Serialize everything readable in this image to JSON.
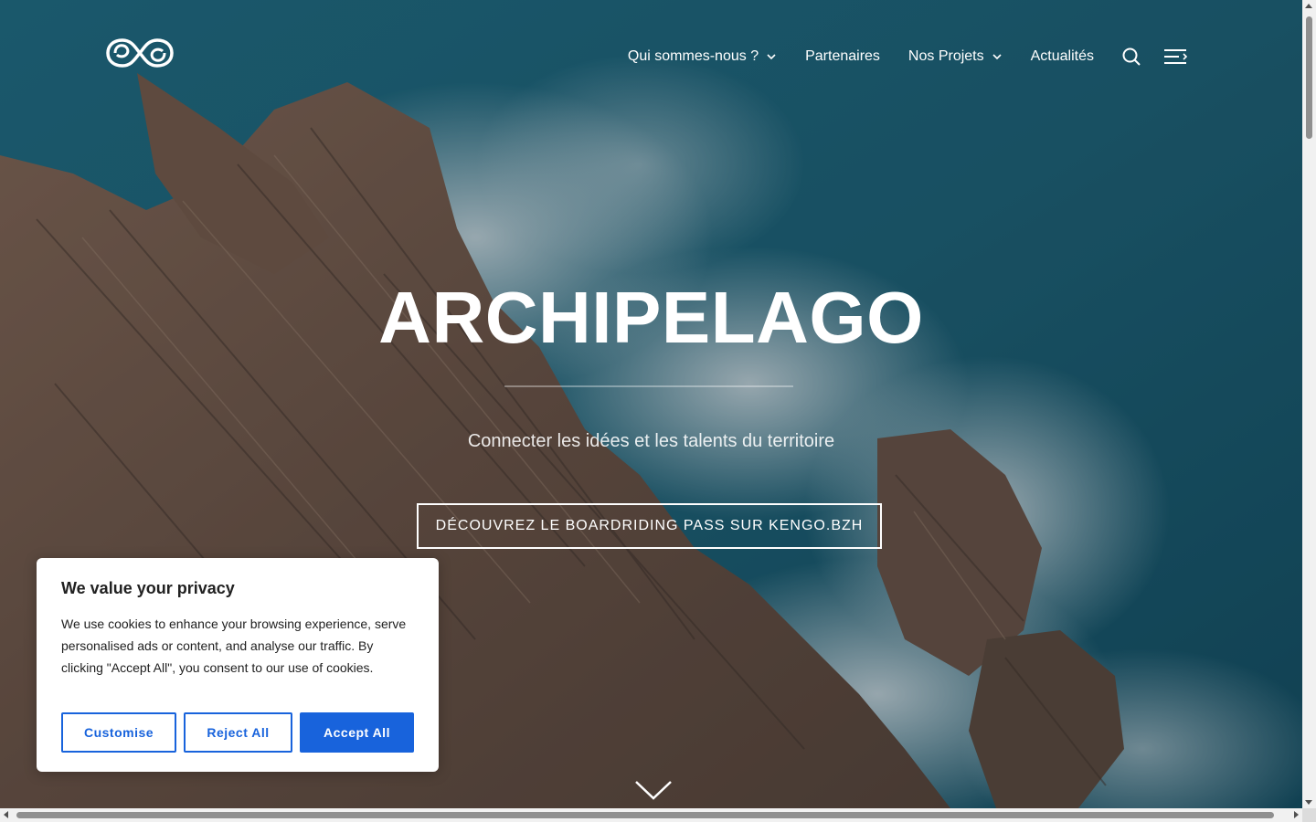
{
  "header": {
    "logo_icon": "archipelago-infinity-logo",
    "nav": [
      {
        "label": "Qui sommes-nous ?",
        "has_dropdown": true
      },
      {
        "label": "Partenaires",
        "has_dropdown": false
      },
      {
        "label": "Nos Projets",
        "has_dropdown": true
      },
      {
        "label": "Actualités",
        "has_dropdown": false
      }
    ],
    "search_icon": "search-icon",
    "menu_icon": "menu-toggle-icon"
  },
  "hero": {
    "title": "ARCHIPELAGO",
    "subtitle": "Connecter les idées et les talents du territoire",
    "cta_label": "DÉCOUVREZ LE BOARDRIDING PASS SUR KENGO.BZH",
    "scroll_icon": "chevron-down-icon"
  },
  "cookie_banner": {
    "title": "We value your privacy",
    "text": "We use cookies to enhance your browsing experience, serve personalised ads or content, and analyse our traffic. By clicking \"Accept All\", you consent to our use of cookies.",
    "customise_label": "Customise",
    "reject_label": "Reject All",
    "accept_label": "Accept All",
    "accent_color": "#1863dc"
  }
}
